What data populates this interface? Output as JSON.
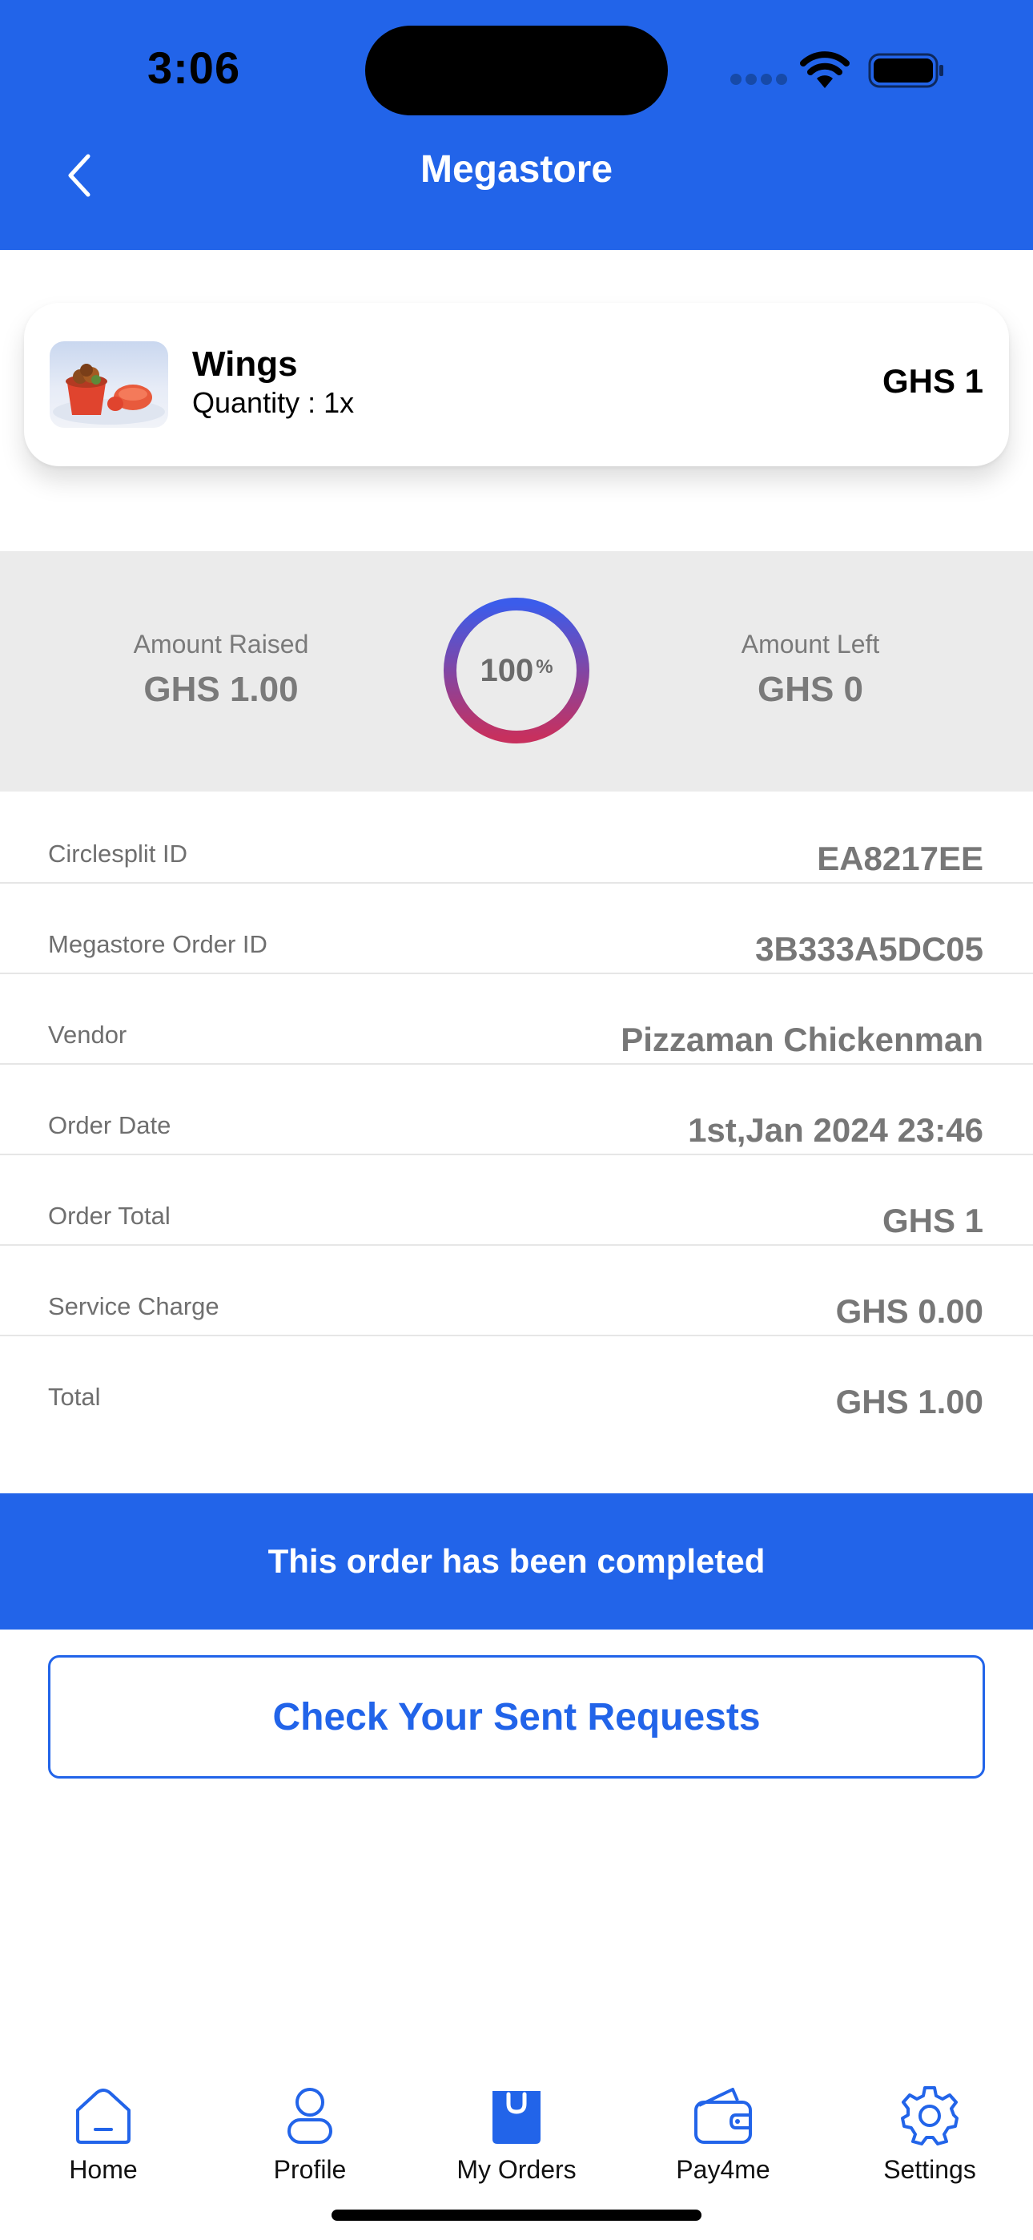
{
  "status_bar": {
    "time": "3:06"
  },
  "header": {
    "title": "Megastore",
    "back_icon": "chevron-left-icon"
  },
  "item": {
    "name": "Wings",
    "quantity": "Quantity : 1x",
    "price": "GHS 1"
  },
  "progress": {
    "raised_label": "Amount Raised",
    "raised_value": "GHS 1.00",
    "left_label": "Amount Left",
    "left_value": "GHS 0",
    "percent": "100",
    "percent_symbol": "%",
    "fraction": 1.0,
    "gradient_start": "#C7305E",
    "gradient_end": "#3B5CEB"
  },
  "details": [
    {
      "label": "Circlesplit ID",
      "value": "EA8217EE"
    },
    {
      "label": "Megastore Order ID",
      "value": "3B333A5DC05"
    },
    {
      "label": "Vendor",
      "value": "Pizzaman Chickenman"
    },
    {
      "label": "Order Date",
      "value": "1st,Jan 2024 23:46"
    },
    {
      "label": "Order Total",
      "value": "GHS 1"
    },
    {
      "label": "Service Charge",
      "value": "GHS 0.00"
    },
    {
      "label": "Total",
      "value": "GHS 1.00"
    }
  ],
  "banner": {
    "text": "This order has been completed"
  },
  "actions": {
    "requests_button": "Check Your Sent Requests"
  },
  "tabbar": {
    "items": [
      {
        "label": "Home",
        "icon": "home-icon",
        "active": false
      },
      {
        "label": "Profile",
        "icon": "profile-icon",
        "active": false
      },
      {
        "label": "My Orders",
        "icon": "shopping-bag-icon",
        "active": true
      },
      {
        "label": "Pay4me",
        "icon": "wallet-icon",
        "active": false
      },
      {
        "label": "Settings",
        "icon": "gear-icon",
        "active": false
      }
    ]
  },
  "colors": {
    "primary": "#2264E9",
    "band": "#EBEBEB",
    "muted_text": "#777777"
  }
}
